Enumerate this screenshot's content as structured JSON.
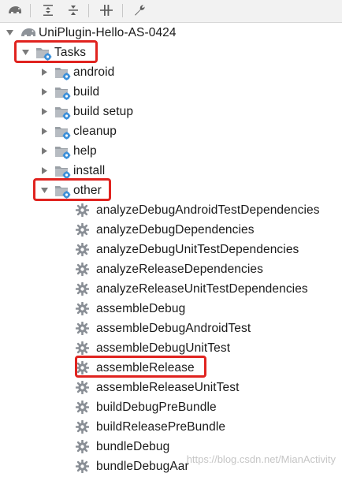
{
  "toolbar": {
    "buttons": [
      {
        "name": "refresh-gradle-icon"
      },
      {
        "name": "expand-all-icon"
      },
      {
        "name": "collapse-all-icon"
      },
      {
        "name": "toggle-offline-icon"
      },
      {
        "name": "settings-wrench-icon"
      }
    ]
  },
  "tree": {
    "root": {
      "label": "UniPlugin-Hello-AS-0424"
    },
    "tasks": {
      "label": "Tasks"
    },
    "groups": [
      {
        "label": "android"
      },
      {
        "label": "build"
      },
      {
        "label": "build setup"
      },
      {
        "label": "cleanup"
      },
      {
        "label": "help"
      },
      {
        "label": "install"
      }
    ],
    "other": {
      "label": "other"
    },
    "other_tasks": [
      {
        "label": "analyzeDebugAndroidTestDependencies"
      },
      {
        "label": "analyzeDebugDependencies"
      },
      {
        "label": "analyzeDebugUnitTestDependencies"
      },
      {
        "label": "analyzeReleaseDependencies"
      },
      {
        "label": "analyzeReleaseUnitTestDependencies"
      },
      {
        "label": "assembleDebug"
      },
      {
        "label": "assembleDebugAndroidTest"
      },
      {
        "label": "assembleDebugUnitTest"
      },
      {
        "label": "assembleRelease"
      },
      {
        "label": "assembleReleaseUnitTest"
      },
      {
        "label": "buildDebugPreBundle"
      },
      {
        "label": "buildReleasePreBundle"
      },
      {
        "label": "bundleDebug"
      },
      {
        "label": "bundleDebugAar"
      }
    ]
  },
  "watermark": "https://blog.csdn.net/MianActivity",
  "colors": {
    "highlight": "#e0231f",
    "folder": "#9aa0a6",
    "gear": "#8a8f96",
    "badge": "#3b8fd9"
  }
}
